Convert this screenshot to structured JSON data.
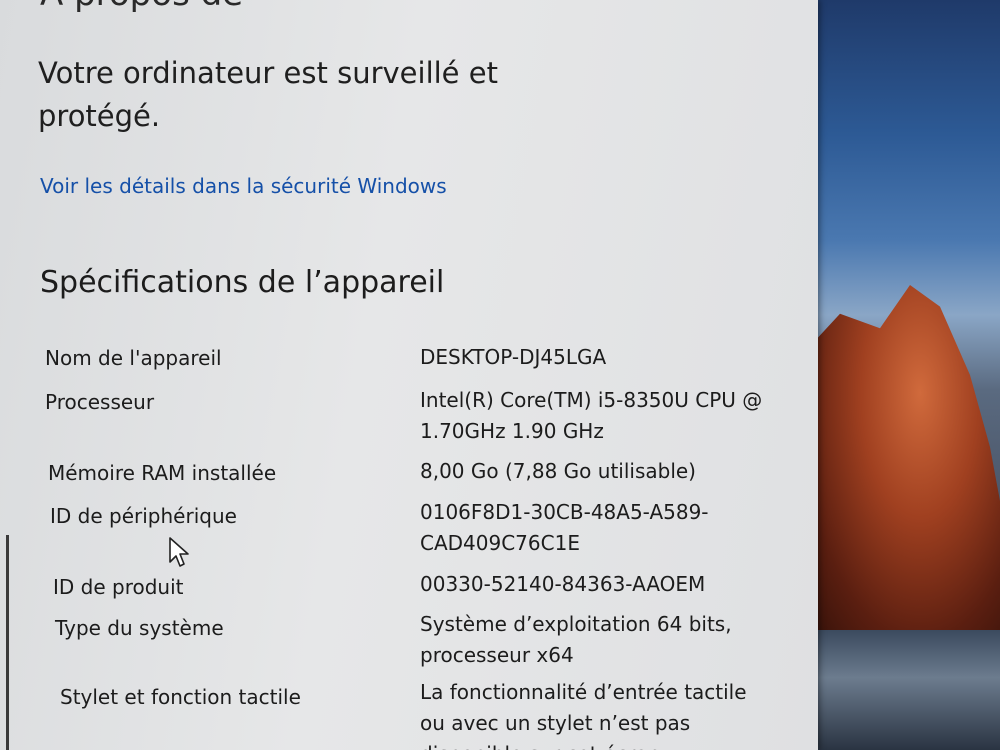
{
  "page": {
    "title_partial": "À propos de"
  },
  "security": {
    "status": "Votre ordinateur est surveillé et protégé.",
    "link": "Voir les détails dans la sécurité Windows"
  },
  "specs": {
    "heading": "Spécifications de l’appareil",
    "rows": [
      {
        "label": "Nom de l'appareil",
        "value": "DESKTOP-DJ45LGA"
      },
      {
        "label": "Processeur",
        "value": "Intel(R) Core(TM) i5-8350U CPU @ 1.70GHz   1.90 GHz"
      },
      {
        "label": "Mémoire RAM installée",
        "value": "8,00 Go (7,88 Go utilisable)"
      },
      {
        "label": "ID de périphérique",
        "value": "0106F8D1-30CB-48A5-A589-CAD409C76C1E"
      },
      {
        "label": "ID de produit",
        "value": "00330-52140-84363-AAOEM"
      },
      {
        "label": "Type du système",
        "value": "Système d’exploitation 64 bits, processeur x64"
      },
      {
        "label": "Stylet et fonction tactile",
        "value": "La fonctionnalité d’entrée tactile ou avec un stylet n’est pas disponible sur cet écran"
      }
    ]
  },
  "colors": {
    "link": "#1550a8",
    "window_bg": "#e3e4e5"
  }
}
